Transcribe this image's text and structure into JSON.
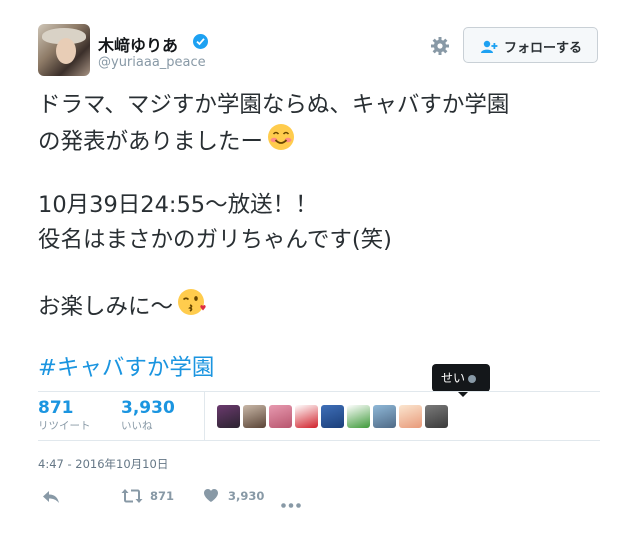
{
  "header": {
    "name": "木﨑ゆりあ",
    "handle": "@yuriaaa_peace",
    "follow_label": "フォローする"
  },
  "tweet": {
    "lines": [
      "ドラマ、マジすか学園ならぬ、キャバすか学園",
      "の発表がありましたー",
      "10月39日24:55〜放送！！",
      "役名はまさかのガリちゃんです(笑)",
      "お楽しみに〜"
    ],
    "hashtag": "#キャバすか学園"
  },
  "tooltip": {
    "text": "せい"
  },
  "stats": {
    "retweets_count": "871",
    "retweets_label": "リツイート",
    "likes_count": "3,930",
    "likes_label": "いいね"
  },
  "liker_avatars": [
    {
      "color_a": "#6b3a6e",
      "color_b": "#2b2330"
    },
    {
      "color_a": "#c9b8a8",
      "color_b": "#5a4436"
    },
    {
      "color_a": "#e79ab0",
      "color_b": "#b8556e"
    },
    {
      "color_a": "#ffffff",
      "color_b": "#d0202a"
    },
    {
      "color_a": "#3f6fb8",
      "color_b": "#1b3f7a"
    },
    {
      "color_a": "#ffffff",
      "color_b": "#3f9a3a"
    },
    {
      "color_a": "#8fb8d8",
      "color_b": "#4f6a86"
    },
    {
      "color_a": "#fbe6d0",
      "color_b": "#e89a7a"
    },
    {
      "color_a": "#7a7a7a",
      "color_b": "#3a3a3a"
    }
  ],
  "timestamp": "4:47 - 2016年10月10日",
  "actions": {
    "retweet_count": "871",
    "like_count": "3,930"
  },
  "colors": {
    "link_blue": "#1b95e0",
    "verified_blue": "#1da1f2",
    "muted": "#8899a6"
  },
  "icons": [
    "verified-badge-icon",
    "gear-icon",
    "add-user-icon",
    "smiling-blush-emoji",
    "kissing-wink-emoji",
    "reply-icon",
    "retweet-icon",
    "heart-icon",
    "more-icon"
  ]
}
